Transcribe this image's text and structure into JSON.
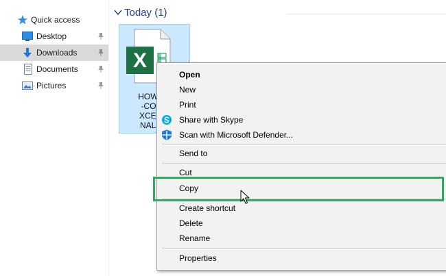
{
  "nav": {
    "items": [
      {
        "label": "Quick access",
        "icon": "star-icon",
        "selected": false
      },
      {
        "label": "Desktop",
        "icon": "desktop-icon",
        "pinned": true,
        "selected": false
      },
      {
        "label": "Downloads",
        "icon": "download-arrow-icon",
        "pinned": true,
        "selected": true
      },
      {
        "label": "Documents",
        "icon": "document-icon",
        "pinned": true,
        "selected": false
      },
      {
        "label": "Pictures",
        "icon": "pictures-icon",
        "pinned": true,
        "selected": false
      }
    ]
  },
  "content": {
    "group_title": "Today (1)",
    "file": {
      "name": "HOW-TO-COPY-EXCEL-FINAL-DA",
      "name_lines": [
        "HOW-TO",
        "-COPY-",
        "XCEL-FI",
        "NAL-DA"
      ],
      "icon": "excel-file-icon",
      "badge": "X"
    }
  },
  "context_menu": {
    "items": [
      {
        "label": "Open",
        "bold": true
      },
      {
        "label": "New"
      },
      {
        "label": "Print"
      },
      {
        "label": "Share with Skype",
        "icon": "skype-icon"
      },
      {
        "label": "Scan with Microsoft Defender...",
        "icon": "defender-shield-icon"
      },
      {
        "label": "Send to"
      },
      {
        "label": "Cut"
      },
      {
        "label": "Copy",
        "highlighted": true
      },
      {
        "label": "Create shortcut"
      },
      {
        "label": "Delete"
      },
      {
        "label": "Rename"
      },
      {
        "label": "Properties"
      }
    ]
  },
  "colors": {
    "selection_blue": "#cce8ff",
    "nav_selected": "#d9d9d9",
    "highlight_green": "#2fa862",
    "excel_green": "#1e7145",
    "title_blue": "#1e3e8c"
  }
}
